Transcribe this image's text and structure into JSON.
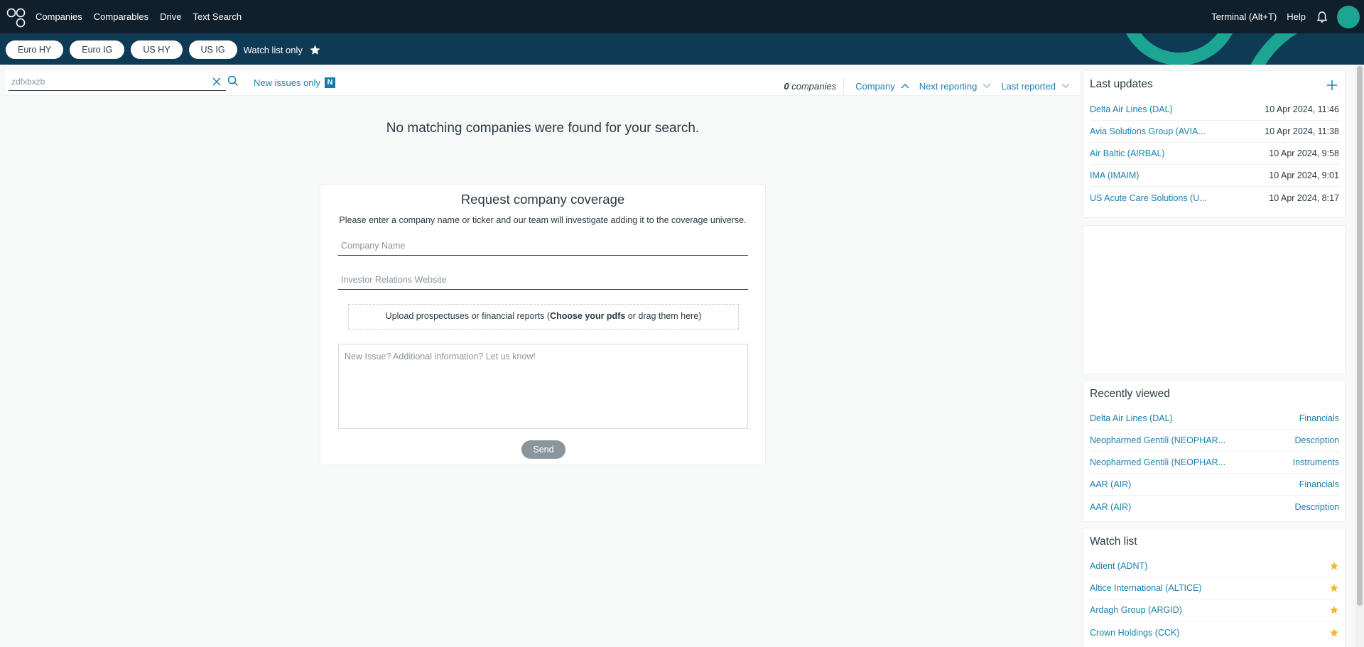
{
  "nav": {
    "items": [
      "Companies",
      "Comparables",
      "Drive",
      "Text Search"
    ],
    "terminal": "Terminal (Alt+T)",
    "help": "Help"
  },
  "filters": {
    "chips": [
      "Euro HY",
      "Euro IG",
      "US HY",
      "US IG"
    ],
    "watch_only": "Watch list only"
  },
  "search": {
    "value": "zdfxbxzb",
    "new_issues": "New issues only",
    "new_badge": "N"
  },
  "results": {
    "count": "0",
    "count_suffix": "companies",
    "sorts": [
      "Company",
      "Next reporting",
      "Last reported"
    ],
    "no_match": "No matching companies were found for your search."
  },
  "request": {
    "title": "Request company coverage",
    "subtitle": "Please enter a company name or ticker and our team will investigate adding it to the coverage universe.",
    "company_placeholder": "Company Name",
    "ir_placeholder": "Investor Relations Website",
    "upload_pre": "Upload prospectuses or financial reports (",
    "upload_bold": "Choose your pdfs",
    "upload_post": " or drag them here)",
    "notes_placeholder": "New Issue? Additional information? Let us know!",
    "send": "Send"
  },
  "last_updates": {
    "title": "Last updates",
    "rows": [
      {
        "name": "Delta Air Lines (DAL)",
        "time": "10 Apr 2024, 11:46"
      },
      {
        "name": "Avia Solutions Group (AVIA...",
        "time": "10 Apr 2024, 11:38"
      },
      {
        "name": "Air Baltic (AIRBAL)",
        "time": "10 Apr 2024, 9:58"
      },
      {
        "name": "IMA (IMAIM)",
        "time": "10 Apr 2024, 9:01"
      },
      {
        "name": "US Acute Care Solutions (U...",
        "time": "10 Apr 2024, 8:17"
      }
    ]
  },
  "recently_viewed": {
    "title": "Recently viewed",
    "rows": [
      {
        "name": "Delta Air Lines (DAL)",
        "section": "Financials"
      },
      {
        "name": "Neopharmed Gentili (NEOPHAR...",
        "section": "Description"
      },
      {
        "name": "Neopharmed Gentili (NEOPHAR...",
        "section": "Instruments"
      },
      {
        "name": "AAR (AIR)",
        "section": "Financials"
      },
      {
        "name": "AAR (AIR)",
        "section": "Description"
      }
    ]
  },
  "watch_list": {
    "title": "Watch list",
    "rows": [
      {
        "name": "Adient (ADNT)"
      },
      {
        "name": "Altice International (ALTICE)"
      },
      {
        "name": "Ardagh Group (ARGID)"
      },
      {
        "name": "Crown Holdings (CCK)"
      }
    ]
  },
  "colors": {
    "topbar": "#0f1f2b",
    "filterbar": "#0f3a55",
    "accent": "#1ba592",
    "link": "#1a7fb0",
    "star": "#f5b731"
  }
}
